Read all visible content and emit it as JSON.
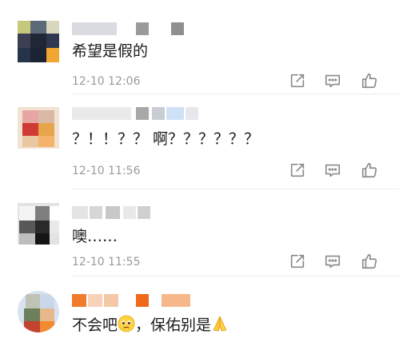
{
  "comments": [
    {
      "text": "希望是假的",
      "time": "12-10 12:06",
      "avatar": "avatar",
      "actions": [
        "share-icon",
        "comment-icon",
        "like-icon"
      ]
    },
    {
      "text": "？！！？？ 啊？？？？？？",
      "time": "12-10 11:56",
      "avatar": "avatar",
      "actions": [
        "share-icon",
        "comment-icon",
        "like-icon"
      ]
    },
    {
      "text": "噢……",
      "time": "12-10 11:55",
      "avatar": "avatar",
      "actions": [
        "share-icon",
        "comment-icon",
        "like-icon"
      ]
    },
    {
      "text_before": "不会吧",
      "emoji_1": "pleading-face-emoji",
      "text_mid": "，保佑别是",
      "emoji_2": "folded-hands-emoji",
      "avatar": "avatar"
    }
  ],
  "colors": {
    "text": "#1a1a1a",
    "meta": "#9a9a9a",
    "icon": "#8a8a8a",
    "divider": "#ededed"
  }
}
